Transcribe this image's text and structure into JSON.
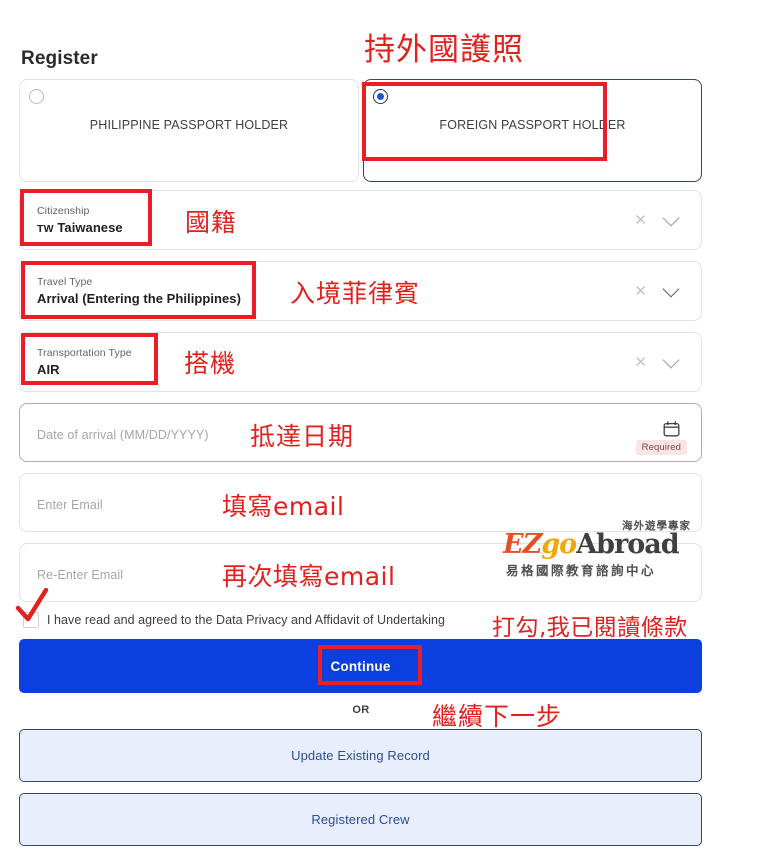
{
  "page": {
    "title": "Register"
  },
  "passport_types": [
    {
      "id": "philippine",
      "label": "PHILIPPINE PASSPORT HOLDER",
      "selected": false
    },
    {
      "id": "foreign",
      "label": "FOREIGN PASSPORT HOLDER",
      "selected": true
    }
  ],
  "fields": {
    "citizenship": {
      "label": "Citizenship",
      "country_code": "TW",
      "value": "Taiwanese"
    },
    "travel_type": {
      "label": "Travel Type",
      "value": "Arrival (Entering the Philippines)"
    },
    "transportation_type": {
      "label": "Transportation Type",
      "value": "AIR"
    },
    "date_of_arrival": {
      "placeholder": "Date of arrival (MM/DD/YYYY)",
      "value": "",
      "badge": "Required"
    },
    "email": {
      "placeholder": "Enter Email",
      "value": ""
    },
    "email_confirm": {
      "placeholder": "Re-Enter Email",
      "value": ""
    }
  },
  "consent": {
    "text": "I have read and agreed to the Data Privacy and Affidavit of Undertaking",
    "checked": false
  },
  "actions": {
    "continue": "Continue",
    "or": "OR",
    "update_existing_record": "Update Existing Record",
    "registered_crew": "Registered Crew"
  },
  "annotations": [
    {
      "id": "foreign-passport",
      "text": "持外國護照"
    },
    {
      "id": "citizenship",
      "text": "國籍"
    },
    {
      "id": "travel-type",
      "text": "入境菲律賓"
    },
    {
      "id": "transportation",
      "text": "搭機"
    },
    {
      "id": "date-of-arrival",
      "text": "抵達日期"
    },
    {
      "id": "email",
      "text": "填寫email"
    },
    {
      "id": "email-confirm",
      "text": "再次填寫email"
    },
    {
      "id": "consent",
      "text": "打勾,我已閱讀條款"
    },
    {
      "id": "continue",
      "text": "繼續下一步"
    }
  ],
  "watermark": {
    "tagline": "海外遊學專家",
    "brand_ez": "EZ",
    "brand_go": "go",
    "brand_abroad": "Abroad",
    "subtitle": "易格國際教育諮詢中心"
  },
  "colors": {
    "primary_blue": "#0b3fe0",
    "radio_blue": "#1a56d6",
    "annotation_red": "#e2211c",
    "box_red": "#ee1c25",
    "secondary_bg": "#e8eefb",
    "secondary_text": "#2a4d9b",
    "required_badge_bg": "#fbe4e4"
  }
}
